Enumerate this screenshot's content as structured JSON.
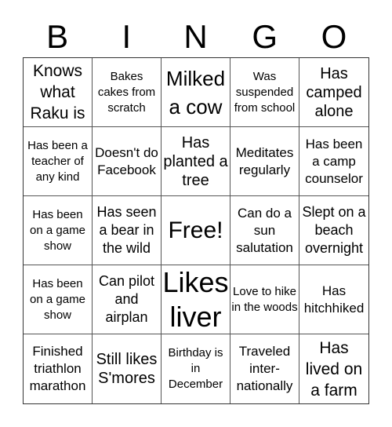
{
  "header": {
    "letters": [
      "B",
      "I",
      "N",
      "G",
      "O"
    ]
  },
  "cells": [
    "Knows what Raku is",
    "Bakes cakes from scratch",
    "Milked a cow",
    "Was suspended from school",
    "Has camped alone",
    "Has been a teacher of any kind",
    "Doesn't do Facebook",
    "Has planted a tree",
    "Meditates regularly",
    "Has been a camp counselor",
    "Has been on a game show",
    "Has seen a bear in the wild",
    "Free!",
    "Can do a sun salutation",
    "Slept on a beach overnight",
    "Has been on a game show",
    "Can pilot and airplan",
    "Likes liver",
    "Love to hike in the woods",
    "Has hitchhiked",
    "Finished triathlon marathon",
    "Still likes S'mores",
    "Birthday is in December",
    "Traveled inter- nationally",
    "Has lived on a farm"
  ]
}
